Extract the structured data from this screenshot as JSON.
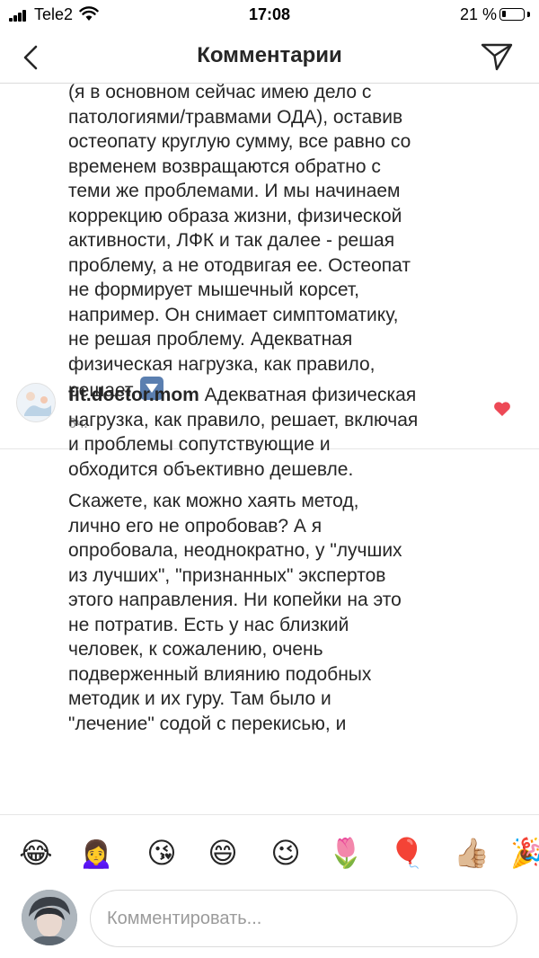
{
  "status_bar": {
    "carrier": "Tele2",
    "time": "17:08",
    "battery_percent": "21 %",
    "battery_level": 0.21
  },
  "header": {
    "title": "Комментарии",
    "back_icon": "chevron-left-icon",
    "send_icon": "paper-plane-icon"
  },
  "comments": [
    {
      "text": "(я в основном сейчас имею дело с\nпатологиями/травмами ОДА), оставив\nостеопату круглую сумму, все равно со\nвременем возвращаются обратно с\nтеми же проблемами. И мы начинаем\nкоррекцию образа жизни, физической\nактивности, ЛФК и так далее - решая\nпроблему, а не отодвигая ее. Остеопат\nне формирует мышечный корсет,\nнапример. Он снимает симптоматику,\nне решая проблему. Адекватная\nфизическая нагрузка, как правило,\nрешает,",
      "trailing_emoji": "down-arrow-button-icon",
      "time": "6ч."
    },
    {
      "username": "fit.doctor.mom",
      "text": " Адекватная физическая\nнагрузка, как правило, решает, включая\nи проблемы сопутствующие и\nобходится объективно дешевле.",
      "text_cont": "Скажете, как можно хаять метод,\nлично его не опробовав? А я\nопробовала, неоднократно, у \"лучших\nиз лучших\", \"признанных\" экспертов\nэтого направления. Ни копейки на это\nне потратив.  Есть у нас близкий\nчеловек, к сожалению, очень\nподверженный влиянию подобных\nметодик и их гуру. Там было и\n\"лечение\" содой с перекисью, и",
      "liked": true,
      "heart_color": "#ed4956"
    }
  ],
  "emoji_bar": [
    "😂",
    "🙍‍♀️",
    "😘",
    "😄",
    "😉",
    "🌷",
    "🎈",
    "👍🏼",
    "🎉"
  ],
  "input": {
    "placeholder": "Комментировать..."
  },
  "colors": {
    "text": "#262626",
    "muted": "#8e8e8e",
    "border": "#dbdbdb"
  }
}
